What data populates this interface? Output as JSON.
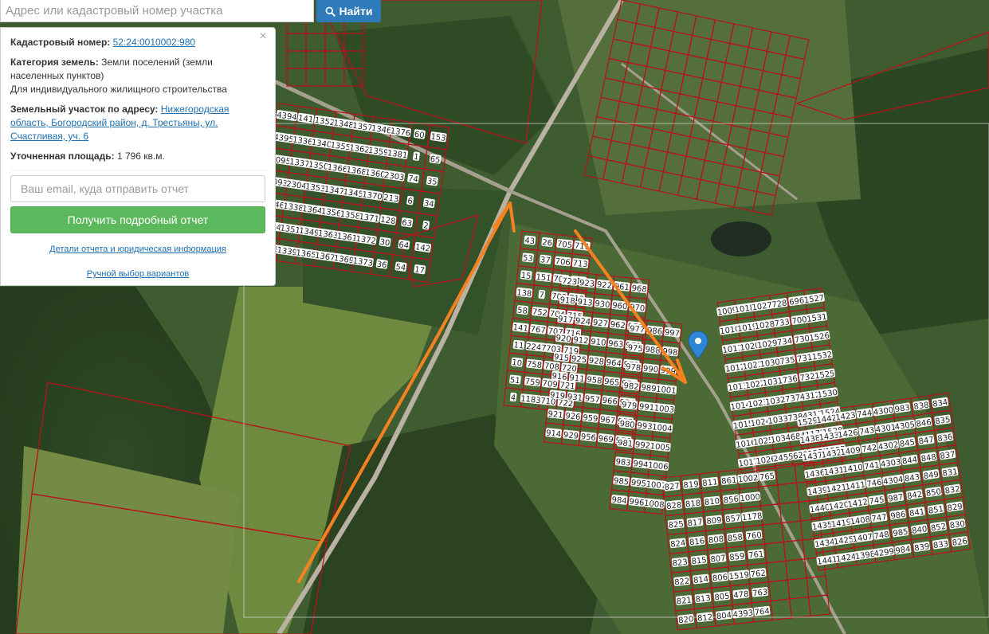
{
  "search": {
    "placeholder": "Адрес или кадастровый номер участка",
    "button_label": "Найти"
  },
  "card": {
    "close_symbol": "×",
    "cadastral_label": "Кадастровый номер:",
    "cadastral_value": "52:24:0010002:980",
    "category_label": "Категория земель:",
    "category_value": "Земли поселений (земли населенных пунктов)",
    "use_value": "Для индивидуального жилищного строительства",
    "address_label": "Земельный участок по адресу:",
    "address_value": "Нижегородская область, Богородский район, д. Трестьяны, ул. Счастливая, уч. 6",
    "area_label": "Уточненная площадь:",
    "area_value": "1 796 кв.м.",
    "email_placeholder": "Ваш email, куда отправить отчет",
    "report_button": "Получить подробный отчет",
    "details_link": "Детали отчета и юридическая информация",
    "manual_link": "Ручной выбор вариантов"
  },
  "map": {
    "colors": {
      "parcel_border": "#b8121b",
      "arrow": "#f58220",
      "marker": "#2f86d6",
      "road": "#b9b2a2"
    },
    "parcel_labels": [
      "4394",
      "4395",
      "1095",
      "1093",
      "4346",
      "1094",
      "4345",
      "141",
      "1336",
      "1337",
      "2304",
      "1338",
      "1351",
      "1339",
      "1352",
      "1340",
      "1350",
      "1353",
      "1364",
      "1349",
      "1365",
      "1348",
      "1355",
      "1366",
      "1347",
      "1356",
      "1363",
      "1367",
      "1357",
      "1362",
      "1368",
      "1345",
      "1358",
      "1361",
      "1369",
      "1346",
      "1359",
      "1360",
      "1370",
      "1371",
      "1372",
      "1373",
      "1376",
      "1381",
      "2303",
      "213",
      "128",
      "30",
      "36",
      "60",
      "1",
      "74",
      "6",
      "63",
      "64",
      "54",
      "153",
      "65",
      "35",
      "34",
      "2",
      "142",
      "17",
      "43",
      "53",
      "15",
      "138",
      "58",
      "141",
      "11",
      "10",
      "51",
      "4",
      "26",
      "37",
      "151",
      "7",
      "752",
      "767",
      "2247",
      "758",
      "759",
      "1183",
      "705",
      "706",
      "701",
      "702",
      "704",
      "707",
      "703",
      "708",
      "709",
      "710",
      "711",
      "713",
      "714",
      "712",
      "715",
      "716",
      "719",
      "720",
      "721",
      "722",
      "723",
      "918",
      "917",
      "920",
      "915",
      "916",
      "919",
      "921",
      "914",
      "923",
      "913",
      "924",
      "912",
      "925",
      "911",
      "931",
      "926",
      "929",
      "922",
      "930",
      "927",
      "910",
      "928",
      "958",
      "957",
      "959",
      "956",
      "961",
      "960",
      "962",
      "963",
      "964",
      "965",
      "966",
      "967",
      "969",
      "968",
      "970",
      "971",
      "972",
      "973",
      "974",
      "954",
      "955",
      "976",
      "977",
      "975",
      "978",
      "982",
      "979",
      "980",
      "981",
      "983",
      "985",
      "984",
      "986",
      "988",
      "990",
      "989",
      "991",
      "993",
      "992",
      "994",
      "995",
      "996",
      "997",
      "998",
      "999",
      "1001",
      "1003",
      "1004",
      "1005",
      "1006",
      "1007",
      "1008",
      "1009",
      "1010",
      "1011",
      "1012",
      "1013",
      "1014",
      "1015",
      "1016",
      "1017",
      "1018",
      "1019",
      "1020",
      "1021",
      "1022",
      "1023",
      "1024",
      "1025",
      "1026",
      "1027",
      "1028",
      "1029",
      "1030",
      "1031",
      "1032",
      "1033",
      "1034",
      "2455",
      "728",
      "733",
      "734",
      "735",
      "736",
      "737",
      "738",
      "684",
      "629",
      "696",
      "700",
      "730",
      "731",
      "732",
      "4312",
      "4311",
      "1172",
      "1533",
      "1527",
      "1531",
      "1526",
      "1532",
      "1525",
      "1530",
      "1524",
      "1528",
      "1523",
      "1529",
      "1438",
      "1437",
      "1436",
      "1439",
      "1440",
      "1435",
      "1434",
      "1441",
      "1442",
      "1433",
      "1432",
      "1431",
      "1421",
      "1420",
      "1419",
      "1425",
      "1424",
      "1423",
      "1426",
      "1409",
      "1410",
      "1411",
      "1412",
      "1408",
      "1407",
      "1398",
      "744",
      "743",
      "742",
      "741",
      "746",
      "745",
      "747",
      "748",
      "4299",
      "4300",
      "4301",
      "4302",
      "4303",
      "4304",
      "987",
      "986",
      "985",
      "984",
      "983",
      "4305",
      "845",
      "844",
      "843",
      "842",
      "841",
      "840",
      "839",
      "838",
      "846",
      "847",
      "848",
      "849",
      "850",
      "851",
      "852",
      "833",
      "834",
      "835",
      "836",
      "837",
      "831",
      "832",
      "829",
      "830",
      "826",
      "827",
      "828",
      "825",
      "824",
      "823",
      "822",
      "821",
      "820",
      "819",
      "818",
      "817",
      "816",
      "815",
      "814",
      "813",
      "812",
      "811",
      "810",
      "809",
      "808",
      "807",
      "806",
      "805",
      "804",
      "861",
      "856",
      "857",
      "858",
      "859",
      "1519",
      "478",
      "4393",
      "1002",
      "1000",
      "1178",
      "760",
      "761",
      "762",
      "763",
      "764",
      "765"
    ]
  }
}
